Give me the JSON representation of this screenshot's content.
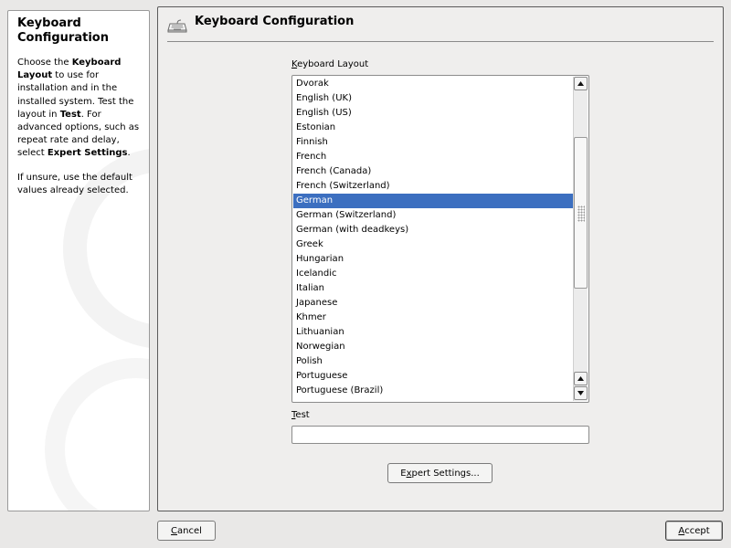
{
  "help": {
    "title": "Keyboard\nConfiguration",
    "p1_a": "Choose the ",
    "p1_b": "Keyboard Layout",
    "p1_c": " to use for installation and in the installed system. Test the layout in ",
    "p1_d": "Test",
    "p1_e": ". For advanced options, such as repeat rate and delay, select ",
    "p1_f": "Expert Settings",
    "p1_g": ".",
    "p2": "If unsure, use the default values already selected."
  },
  "header": {
    "title": "Keyboard Configuration",
    "icon": "keyboard-icon"
  },
  "layout_field": {
    "label_mnemonic": "K",
    "label_rest": "eyboard Layout",
    "selected": "German",
    "items": [
      "Dvorak",
      "English (UK)",
      "English (US)",
      "Estonian",
      "Finnish",
      "French",
      "French (Canada)",
      "French (Switzerland)",
      "German",
      "German (Switzerland)",
      "German (with deadkeys)",
      "Greek",
      "Hungarian",
      "Icelandic",
      "Italian",
      "Japanese",
      "Khmer",
      "Lithuanian",
      "Norwegian",
      "Polish",
      "Portuguese",
      "Portuguese (Brazil)"
    ]
  },
  "test_field": {
    "label_mnemonic": "T",
    "label_rest": "est",
    "value": ""
  },
  "buttons": {
    "expert_a": "E",
    "expert_mnemonic": "x",
    "expert_b": "pert Settings...",
    "cancel_mnemonic": "C",
    "cancel_rest": "ancel",
    "accept_mnemonic": "A",
    "accept_rest": "ccept"
  },
  "colors": {
    "selection": "#3c6fc0",
    "window_bg": "#e9e8e7"
  }
}
